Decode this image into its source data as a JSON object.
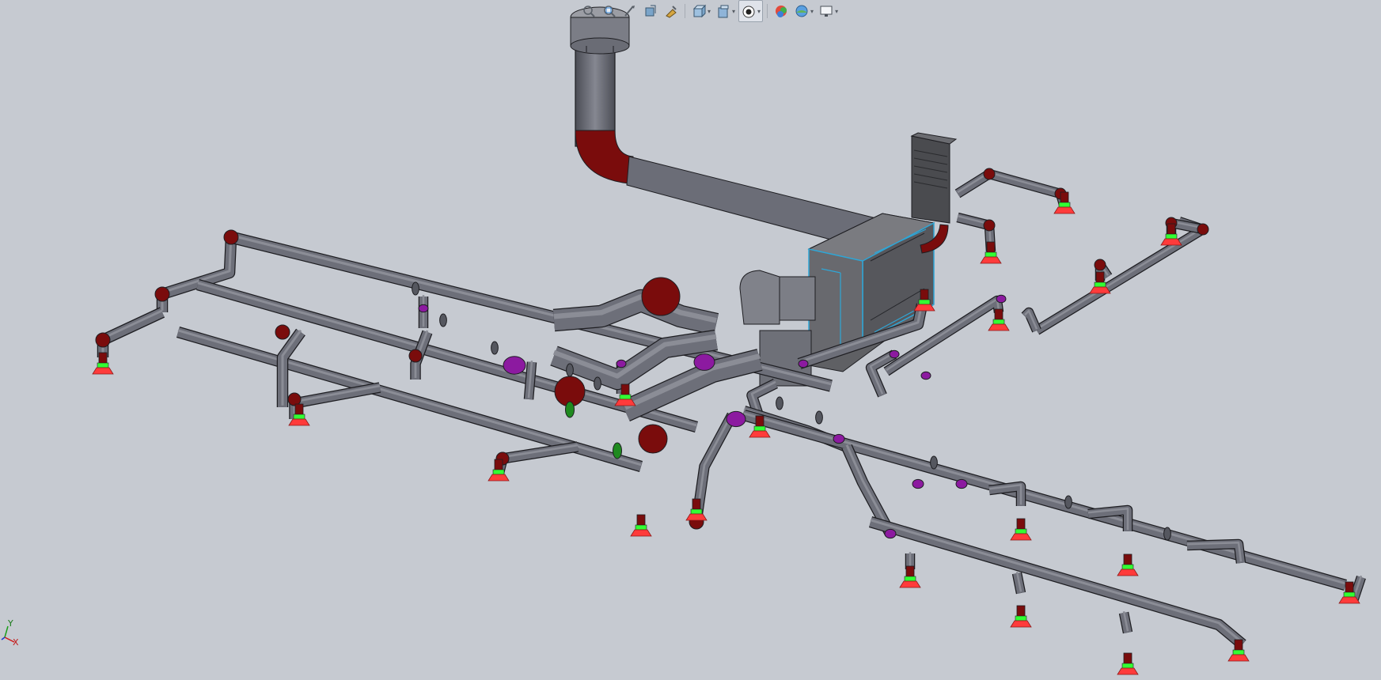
{
  "toolbar": {
    "buttons": [
      {
        "icon": "zoom-to-fit-icon",
        "dropdown": false,
        "active": false
      },
      {
        "icon": "zoom-to-area-icon",
        "dropdown": false,
        "active": false
      },
      {
        "icon": "previous-view-icon",
        "dropdown": false,
        "active": false
      },
      {
        "icon": "section-view-icon",
        "dropdown": false,
        "active": false
      },
      {
        "icon": "dynamic-annotation-views-icon",
        "dropdown": false,
        "active": false
      },
      {
        "icon": "view-orientation-icon",
        "dropdown": true,
        "active": false
      },
      {
        "icon": "display-style-icon",
        "dropdown": true,
        "active": false
      },
      {
        "icon": "hide-show-items-icon",
        "dropdown": true,
        "active": true
      },
      {
        "icon": "edit-appearance-icon",
        "dropdown": false,
        "active": false
      },
      {
        "icon": "apply-scene-icon",
        "dropdown": true,
        "active": false
      },
      {
        "icon": "view-settings-icon",
        "dropdown": true,
        "active": false
      }
    ]
  },
  "triad": {
    "x_label": "X",
    "y_label": "Y"
  },
  "colors": {
    "background": "#c6cad1",
    "duct": "#6d6f79",
    "duct_highlight": "#8b8d96",
    "elbow_red": "#7a0c0c",
    "tee_purple": "#8c1aa0",
    "coupling_green": "#1f8a1f",
    "diffuser_red": "#ff3b3b",
    "diffuser_collar_green": "#33ff33",
    "unit_body": "#5e5e62",
    "unit_edge": "#2fa6d6"
  }
}
